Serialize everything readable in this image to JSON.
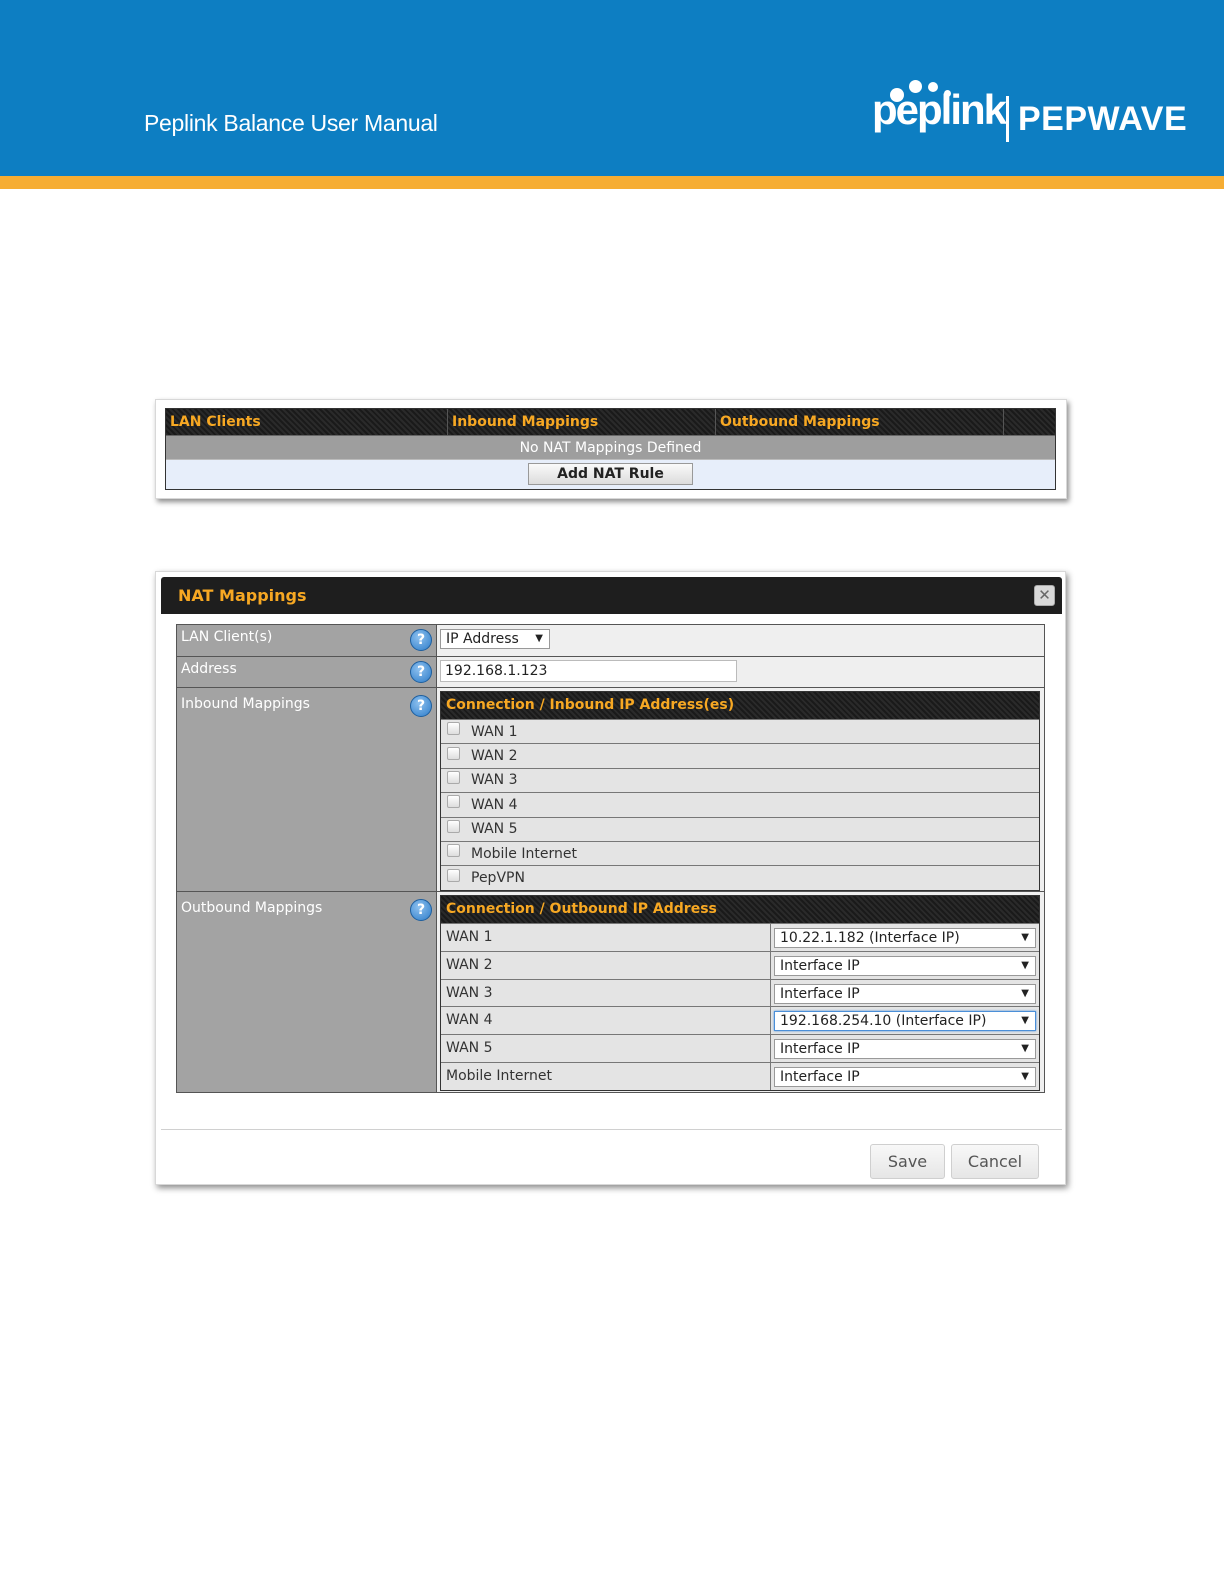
{
  "header": {
    "manual_title": "Peplink Balance User Manual",
    "logo_left": "peplink",
    "logo_right": "PEPWAVE",
    "banner_color": "#0d7ec2",
    "stripe_color": "#f6ad33"
  },
  "nat_list": {
    "columns": [
      "LAN Clients",
      "Inbound Mappings",
      "Outbound Mappings"
    ],
    "empty_message": "No NAT Mappings Defined",
    "add_button": "Add NAT Rule"
  },
  "dialog": {
    "title": "NAT Mappings",
    "close_icon": "close-icon",
    "fields": {
      "lan_clients": {
        "label": "LAN Client(s)",
        "value": "IP Address"
      },
      "address": {
        "label": "Address",
        "value": "192.168.1.123"
      },
      "inbound": {
        "label": "Inbound Mappings",
        "header": "Connection / Inbound IP Address(es)",
        "items": [
          "WAN 1",
          "WAN 2",
          "WAN 3",
          "WAN 4",
          "WAN 5",
          "Mobile Internet",
          "PepVPN"
        ]
      },
      "outbound": {
        "label": "Outbound Mappings",
        "header": "Connection / Outbound IP Address",
        "rows": [
          {
            "name": "WAN 1",
            "value": "10.22.1.182 (Interface IP)"
          },
          {
            "name": "WAN 2",
            "value": "Interface IP"
          },
          {
            "name": "WAN 3",
            "value": "Interface IP"
          },
          {
            "name": "WAN 4",
            "value": "192.168.254.10 (Interface IP)"
          },
          {
            "name": "WAN 5",
            "value": "Interface IP"
          },
          {
            "name": "Mobile Internet",
            "value": "Interface IP"
          }
        ]
      }
    },
    "help_icon": "?",
    "save_label": "Save",
    "cancel_label": "Cancel",
    "accent_color": "#f7a823"
  }
}
